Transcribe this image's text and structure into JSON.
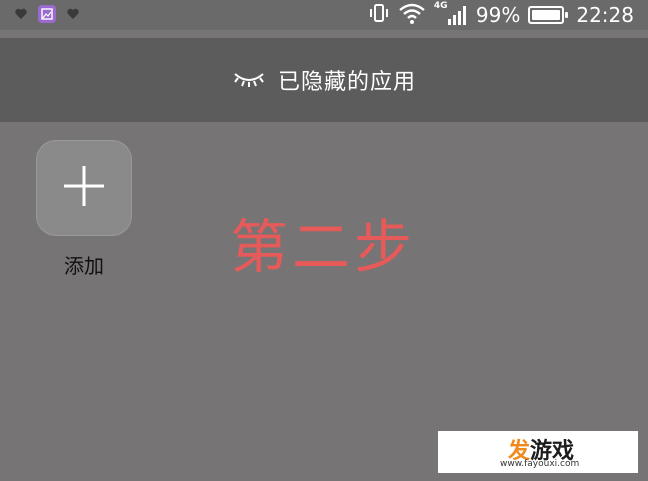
{
  "status_bar": {
    "battery_percent": "99%",
    "battery_level": 0.99,
    "time": "22:28",
    "network": "4G",
    "icons": [
      "heart-notification-icon",
      "gallery-icon",
      "heart-notification-icon",
      "vibrate-icon",
      "wifi-icon",
      "signal-icon",
      "battery-icon"
    ]
  },
  "header": {
    "title": "已隐藏的应用",
    "icon": "closed-eye-icon"
  },
  "apps": {
    "add_label": "添加",
    "add_icon": "plus-icon"
  },
  "annotation": {
    "text": "第二步",
    "color": "#e65a5a"
  },
  "watermark": {
    "logo_first": "发",
    "logo_rest": "游戏",
    "url": "www.fayouxi.com"
  }
}
